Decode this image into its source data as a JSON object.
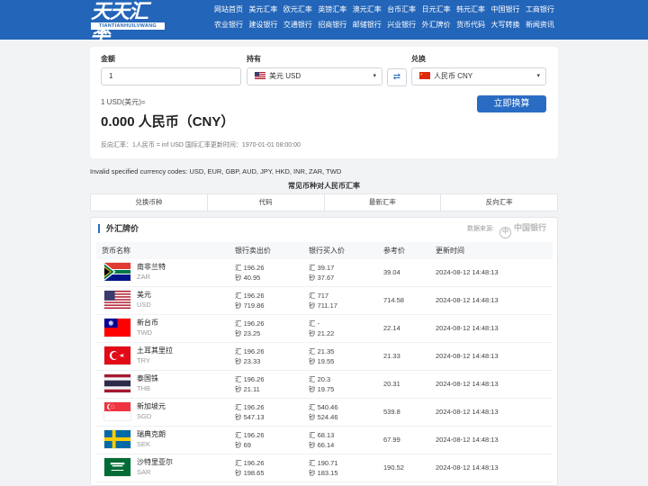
{
  "logo": {
    "main": "天天汇率",
    "sub": "TIANTIANHUILVWANG"
  },
  "nav": [
    "网站首页",
    "美元汇率",
    "欧元汇率",
    "英镑汇率",
    "澳元汇率",
    "台币汇率",
    "日元汇率",
    "韩元汇率",
    "中国银行",
    "工商银行",
    "农业银行",
    "建设银行",
    "交通银行",
    "招商银行",
    "邮储银行",
    "兴业银行",
    "外汇牌价",
    "货币代码",
    "大写转换",
    "新闻资讯"
  ],
  "converter": {
    "amount_label": "金额",
    "amount_value": "1",
    "hold_label": "持有",
    "hold_value": "美元 USD",
    "exchange_label": "兑换",
    "exchange_value": "人民币 CNY",
    "result_small": "1 USD(美元)=",
    "result_big": "0.000 人民币（CNY）",
    "reverse": "反向汇率：1人民币 = inf USD  国际汇率更新时间：1970-01-01 08:00:00",
    "button": "立即换算"
  },
  "error_text": "Invalid specified currency codes: USD, EUR, GBP, AUD, JPY, HKD, INR, ZAR, TWD",
  "common": {
    "title": "常见币种对人民币汇率",
    "headers": [
      "兑换币种",
      "代码",
      "最新汇率",
      "反向汇率"
    ]
  },
  "rates": {
    "title": "外汇牌价",
    "source_label": "数据来源:",
    "bank_name": "中国银行",
    "headers": [
      "货币名称",
      "银行卖出价",
      "银行买入价",
      "参考价",
      "更新时间"
    ],
    "rows": [
      {
        "name": "南非兰特",
        "code": "ZAR",
        "sell_h": "汇 196.26",
        "sell_c": "钞 40.95",
        "buy_h": "汇 39.17",
        "buy_c": "钞 37.67",
        "ref": "39.04",
        "time": "2024-08-12 14:48:13"
      },
      {
        "name": "美元",
        "code": "USD",
        "sell_h": "汇 196.26",
        "sell_c": "钞 719.86",
        "buy_h": "汇 717",
        "buy_c": "钞 711.17",
        "ref": "714.58",
        "time": "2024-08-12 14:48:13"
      },
      {
        "name": "新台币",
        "code": "TWD",
        "sell_h": "汇 196.26",
        "sell_c": "钞 23.25",
        "buy_h": "汇 -",
        "buy_c": "钞 21.22",
        "ref": "22.14",
        "time": "2024-08-12 14:48:13"
      },
      {
        "name": "土耳其里拉",
        "code": "TRY",
        "sell_h": "汇 196.26",
        "sell_c": "钞 23.33",
        "buy_h": "汇 21.35",
        "buy_c": "钞 19.55",
        "ref": "21.33",
        "time": "2024-08-12 14:48:13"
      },
      {
        "name": "泰国铢",
        "code": "THB",
        "sell_h": "汇 196.26",
        "sell_c": "钞 21.11",
        "buy_h": "汇 20.3",
        "buy_c": "钞 19.75",
        "ref": "20.31",
        "time": "2024-08-12 14:48:13"
      },
      {
        "name": "新加坡元",
        "code": "SGD",
        "sell_h": "汇 196.26",
        "sell_c": "钞 547.13",
        "buy_h": "汇 540.46",
        "buy_c": "钞 524.46",
        "ref": "539.8",
        "time": "2024-08-12 14:48:13"
      },
      {
        "name": "瑞典克朗",
        "code": "SEK",
        "sell_h": "汇 196.26",
        "sell_c": "钞 69",
        "buy_h": "汇 68.13",
        "buy_c": "钞 66.14",
        "ref": "67.99",
        "time": "2024-08-12 14:48:13"
      },
      {
        "name": "沙特里亚尔",
        "code": "SAR",
        "sell_h": "汇 196.26",
        "sell_c": "钞 198.65",
        "buy_h": "汇 190.71",
        "buy_c": "钞 183.15",
        "ref": "190.52",
        "time": "2024-08-12 14:48:13"
      }
    ]
  },
  "colors": {
    "brand": "#2365b8",
    "accent": "#2a6cc4"
  }
}
